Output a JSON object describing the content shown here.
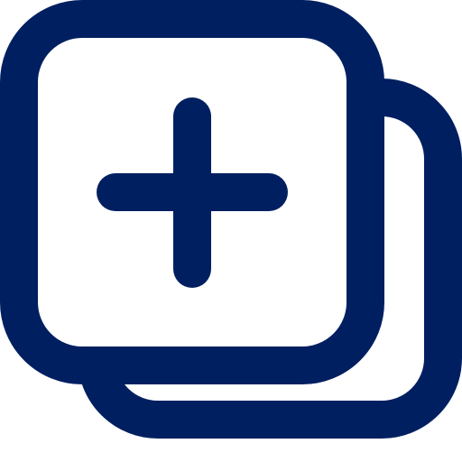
{
  "icon": {
    "name": "add-copy-icon",
    "stroke_color": "#001F60"
  }
}
